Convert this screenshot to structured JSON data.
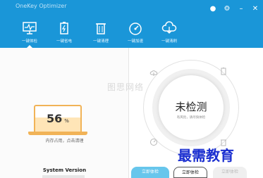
{
  "window": {
    "title": "OneKey Optimizer",
    "controls": [
      {
        "name": "skin",
        "glyph": "●"
      },
      {
        "name": "settings",
        "glyph": "⚙"
      },
      {
        "name": "minimize",
        "glyph": "–"
      },
      {
        "name": "close",
        "glyph": "✕"
      }
    ]
  },
  "nav": {
    "items": [
      {
        "label": "一键体检",
        "icon": "monitor-pulse-icon"
      },
      {
        "label": "一键省电",
        "icon": "battery-icon"
      },
      {
        "label": "一键清理",
        "icon": "trash-icon"
      },
      {
        "label": "一键加速",
        "icon": "speedometer-icon"
      },
      {
        "label": "一键清刷",
        "icon": "cloud-icon"
      }
    ]
  },
  "memory": {
    "value": "56",
    "unit": "%",
    "usage_fraction": 0.56,
    "hint": "内存占用，点击清理"
  },
  "system": {
    "label": "System Version"
  },
  "watermark": "图思网络",
  "status": {
    "main": "未检测",
    "sub": "有风险，请尽快体检"
  },
  "buttons": {
    "primary": "立即体检",
    "outline": "立即体检",
    "disabled": "立即体检"
  },
  "brand_overlay": "最需教育",
  "colors": {
    "header": "#1a96d8",
    "laptop_border": "#f1b357",
    "laptop_fill": "#ffe5b7",
    "brand": "#1b2fd0"
  }
}
